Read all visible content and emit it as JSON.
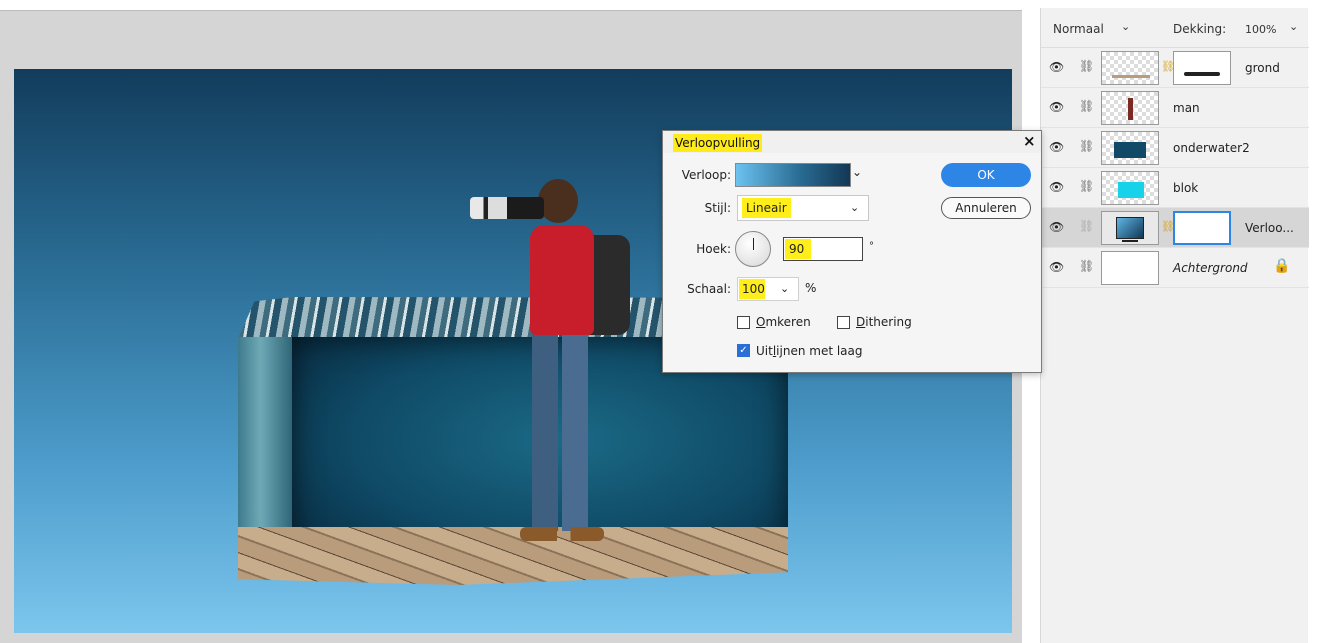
{
  "layers_panel": {
    "blend_mode": "Normaal",
    "opacity_label": "Dekking:",
    "opacity_value": "100%",
    "layers": [
      {
        "name": "grond",
        "has_mask": true,
        "selected": false
      },
      {
        "name": "man",
        "has_mask": false,
        "selected": false
      },
      {
        "name": "onderwater2",
        "has_mask": false,
        "selected": false
      },
      {
        "name": "blok",
        "has_mask": false,
        "selected": false
      },
      {
        "name": "Verloo...",
        "has_mask": true,
        "selected": true
      },
      {
        "name": "Achtergrond",
        "has_mask": false,
        "selected": false,
        "locked": true
      }
    ]
  },
  "dialog": {
    "title": "Verloopvulling",
    "close_glyph": "×",
    "gradient_label": "Verloop:",
    "style_label": "Stijl:",
    "style_value": "Lineair",
    "angle_label": "Hoek:",
    "angle_value": "90",
    "angle_unit": "°",
    "scale_label": "Schaal:",
    "scale_value": "100",
    "scale_unit": "%",
    "reverse_label_u": "O",
    "reverse_label_rest": "mkeren",
    "reverse_checked": false,
    "dither_label_u": "D",
    "dither_label_rest": "ithering",
    "dither_checked": false,
    "align_label_a": "Uit",
    "align_label_u": "l",
    "align_label_b": "ijnen met laag",
    "align_checked": true,
    "ok_label": "OK",
    "cancel_label": "Annuleren",
    "gradient_colors": [
      "#6cc2ef",
      "#2a6d95",
      "#133755"
    ]
  },
  "icons": {
    "eye": "◉",
    "link": "⛓",
    "chevron": "✔",
    "check": "✓"
  }
}
